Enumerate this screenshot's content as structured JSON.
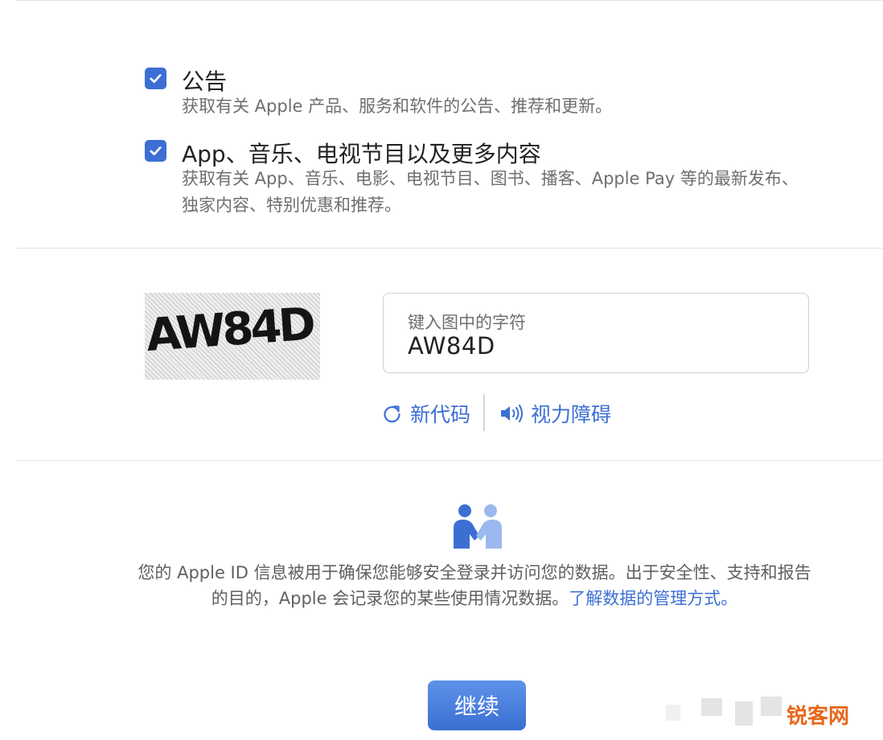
{
  "options": [
    {
      "title": "公告",
      "description": "获取有关 Apple 产品、服务和软件的公告、推荐和更新。",
      "checked": true
    },
    {
      "title": "App、音乐、电视节目以及更多内容",
      "description": "获取有关 App、音乐、电影、电视节目、图书、播客、Apple Pay 等的最新发布、独家内容、特别优惠和推荐。",
      "checked": true
    }
  ],
  "captcha": {
    "image_text": "AW84D",
    "field_label": "键入图中的字符",
    "field_value": "AW84D",
    "new_code_label": "新代码",
    "new_code_icon": "refresh-icon",
    "accessibility_label": "视力障碍",
    "accessibility_icon": "speaker-icon"
  },
  "privacy": {
    "icon": "handshake-people-icon",
    "text": "您的 Apple ID 信息被用于确保您能够安全登录并访问您的数据。出于安全性、支持和报告的目的，Apple 会记录您的某些使用情况数据。",
    "link_text": "了解数据的管理方式。"
  },
  "continue_label": "继续",
  "watermark": {
    "logo_text": "锐客网"
  },
  "colors": {
    "accent": "#3c6fd4",
    "button_top": "#5f92e9",
    "button_bottom": "#3a6fd3",
    "muted_text": "#6e6e73",
    "divider": "#e3e3e6",
    "watermark": "#e8681a"
  }
}
